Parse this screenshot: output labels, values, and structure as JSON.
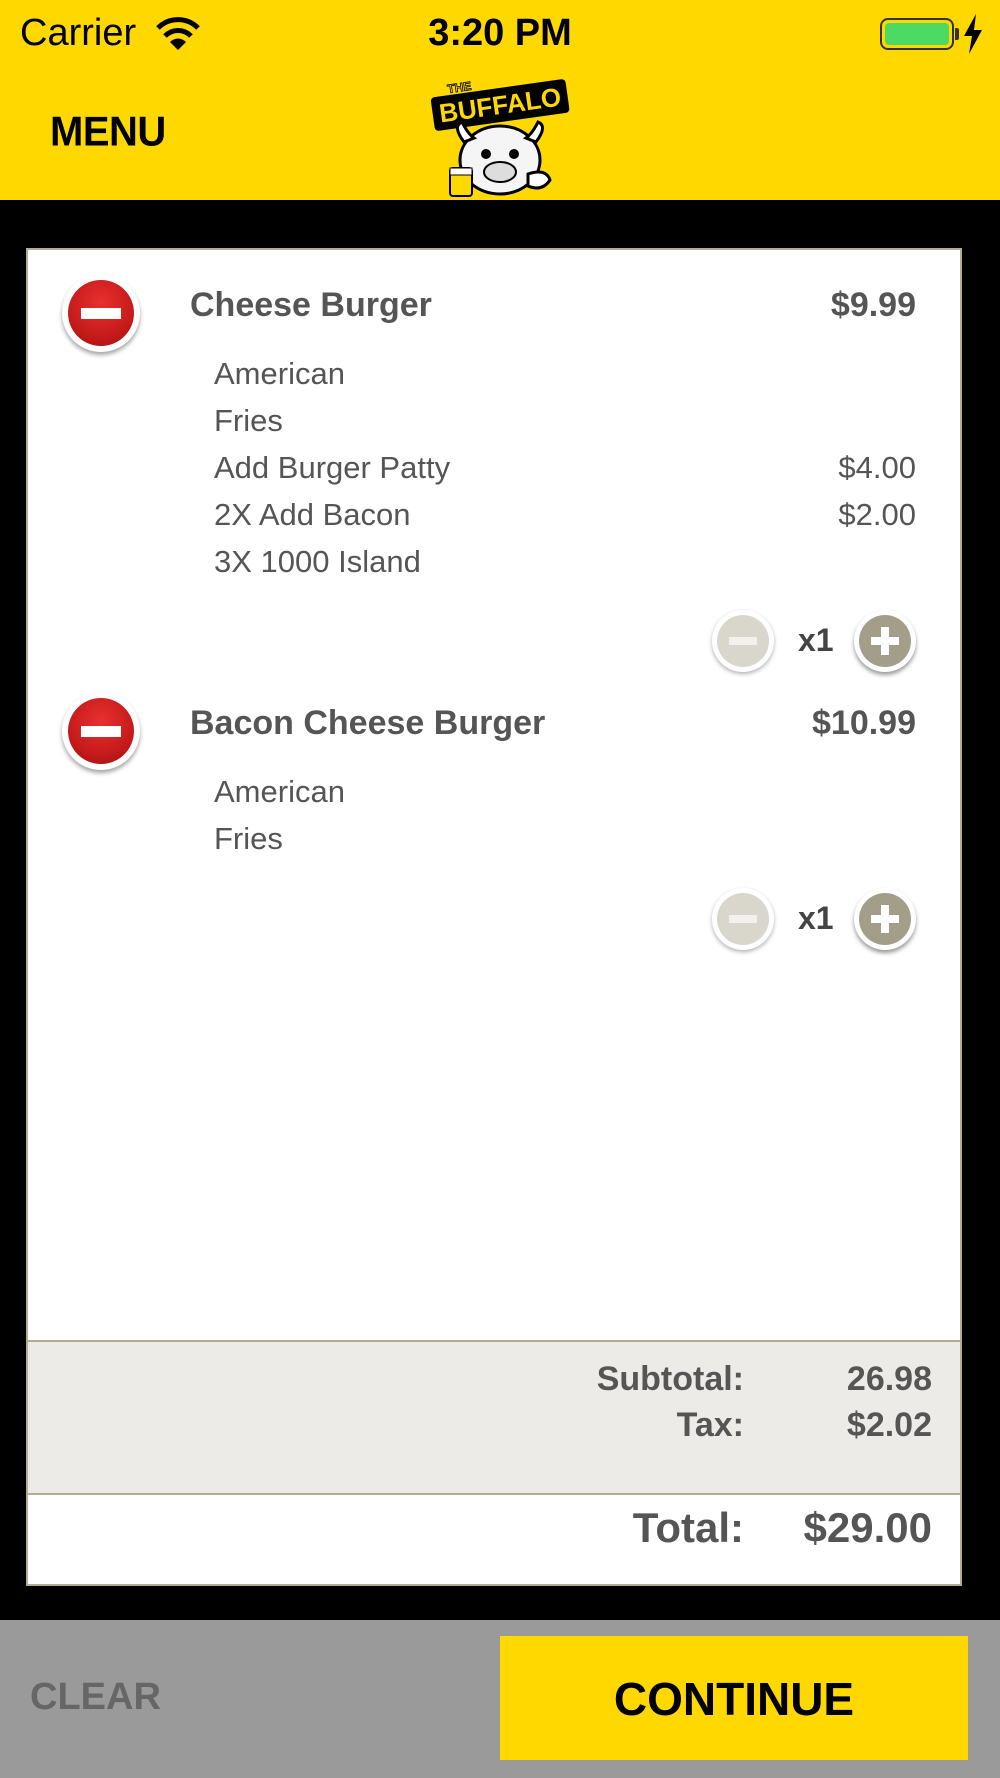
{
  "status_bar": {
    "carrier": "Carrier",
    "time": "3:20 PM"
  },
  "header": {
    "menu_label": "MENU",
    "logo_text_top": "THE",
    "logo_text_main": "BUFFALO"
  },
  "order": {
    "items": [
      {
        "name": "Cheese Burger",
        "price": "$9.99",
        "modifiers": [
          {
            "name": "American",
            "price": ""
          },
          {
            "name": "Fries",
            "price": ""
          },
          {
            "name": "Add Burger Patty",
            "price": "$4.00"
          },
          {
            "name": "2X Add Bacon",
            "price": "$2.00"
          },
          {
            "name": "3X 1000 Island",
            "price": ""
          }
        ],
        "quantity": "x1"
      },
      {
        "name": "Bacon Cheese Burger",
        "price": "$10.99",
        "modifiers": [
          {
            "name": "American",
            "price": ""
          },
          {
            "name": "Fries",
            "price": ""
          }
        ],
        "quantity": "x1"
      }
    ]
  },
  "totals": {
    "subtotal_label": "Subtotal:",
    "subtotal_value": "26.98",
    "tax_label": "Tax:",
    "tax_value": "$2.02",
    "total_label": "Total:",
    "total_value": "$29.00"
  },
  "footer": {
    "clear_label": "CLEAR",
    "continue_label": "CONTINUE"
  },
  "colors": {
    "brand_yellow": "#FFD800",
    "remove_red": "#D21F1F",
    "text_gray": "#555555",
    "footer_gray": "#9A9A9A"
  }
}
